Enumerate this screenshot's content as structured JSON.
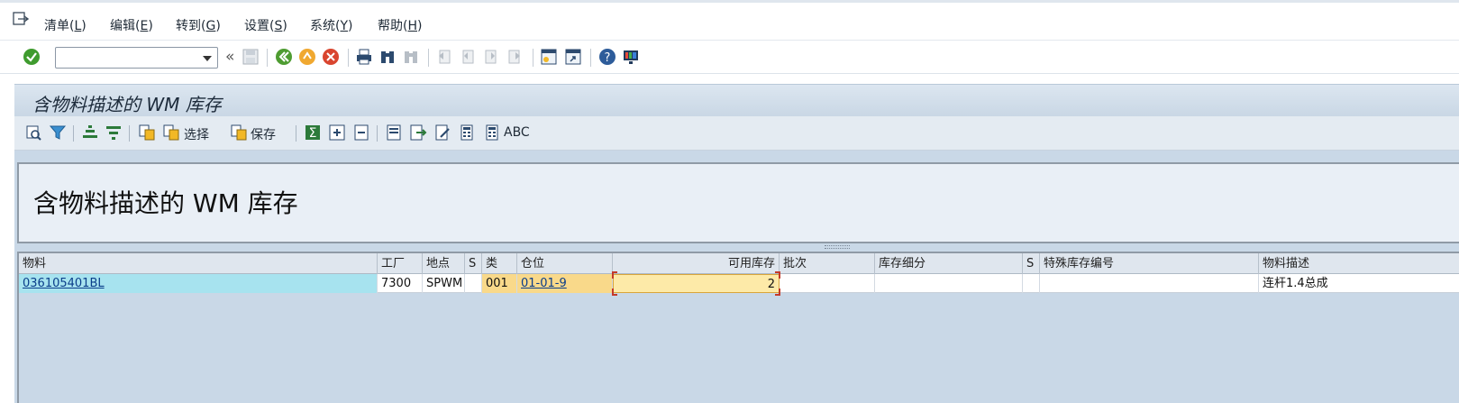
{
  "menu": {
    "items": [
      {
        "label": "清单(",
        "acc": "L",
        "end": ")"
      },
      {
        "label": "编辑(",
        "acc": "E",
        "end": ")"
      },
      {
        "label": "转到(",
        "acc": "G",
        "end": ")"
      },
      {
        "label": "设置(",
        "acc": "S",
        "end": ")"
      },
      {
        "label": "系统(",
        "acc": "Y",
        "end": ")"
      },
      {
        "label": "帮助(",
        "acc": "H",
        "end": ")"
      }
    ]
  },
  "command_field": {
    "value": ""
  },
  "title": "含物料描述的 WM 库存",
  "app_toolbar": {
    "select_label": "选择",
    "save_label": "保存",
    "abc_label": "ABC"
  },
  "report_title": "含物料描述的 WM 库存",
  "grid": {
    "columns": [
      "物料",
      "工厂",
      "地点",
      "S",
      "类",
      "仓位",
      "可用库存",
      "批次",
      "库存细分",
      "S",
      "特殊库存编号",
      "物料描述"
    ],
    "rows": [
      {
        "material": "036105401BL",
        "plant": "7300",
        "location": "SPWM",
        "s": "",
        "type": "001",
        "bin": "01-01-9",
        "available": "2",
        "batch": "",
        "stock_category": "",
        "s2": "",
        "special_stock_no": "",
        "description": "连杆1.4总成"
      }
    ]
  },
  "colors": {
    "title_bar": "#c9d7e5",
    "work_area": "#c9d8e7",
    "key_cell": "#a7e3ef",
    "highlight_cell": "#f9d98a"
  }
}
